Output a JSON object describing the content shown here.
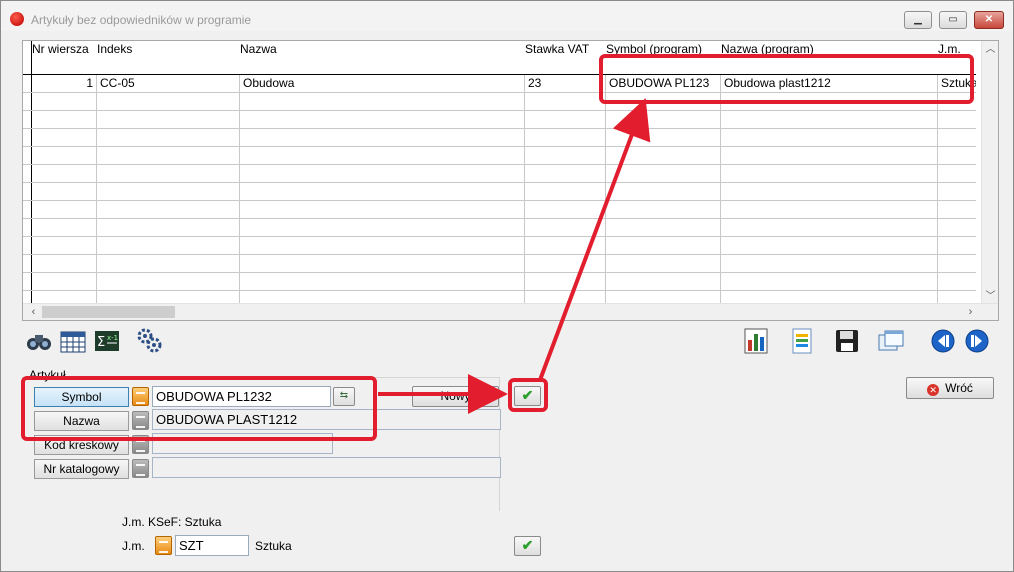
{
  "window": {
    "title": "Artykuły bez odpowiedników w programie",
    "minimize_icon": "minimize-icon",
    "maximize_icon": "maximize-icon",
    "close_icon": "close-icon"
  },
  "grid": {
    "columns": [
      "Nr wiersza",
      "Indeks",
      "Nazwa",
      "Stawka VAT",
      "Symbol (program)",
      "Nazwa (program)",
      "J.m."
    ],
    "rows": [
      {
        "nr": "1",
        "indeks": "CC-05",
        "nazwa": "Obudowa",
        "vat": "23",
        "symbol_prog": "OBUDOWA PL123",
        "nazwa_prog": "Obudowa plast1212",
        "jm": "Sztuka"
      }
    ]
  },
  "toolbar_left": [
    "binoculars-icon",
    "calendar-grid-icon",
    "sum-formula-icon",
    "cogs-icon"
  ],
  "toolbar_right": [
    "bar-chart-icon",
    "document-icon",
    "save-icon",
    "windows-icon",
    "prev-icon",
    "next-icon"
  ],
  "article": {
    "legend": "Artykuł",
    "symbol_label": "Symbol",
    "symbol_value": "OBUDOWA PL1232",
    "name_label": "Nazwa",
    "name_value": "OBUDOWA PLAST1212",
    "barcode_label": "Kod kreskowy",
    "barcode_value": "",
    "catalog_label": "Nr katalogowy",
    "catalog_value": "",
    "new_button": "Nowy"
  },
  "back_button": "Wróć",
  "unit": {
    "ksef_label": "J.m. KSeF: Sztuka",
    "jm_label": "J.m.",
    "jm_value": "SZT",
    "jm_name": "Sztuka"
  },
  "colors": {
    "annotation_red": "#e21d2e",
    "ok_green": "#2ca02c"
  }
}
